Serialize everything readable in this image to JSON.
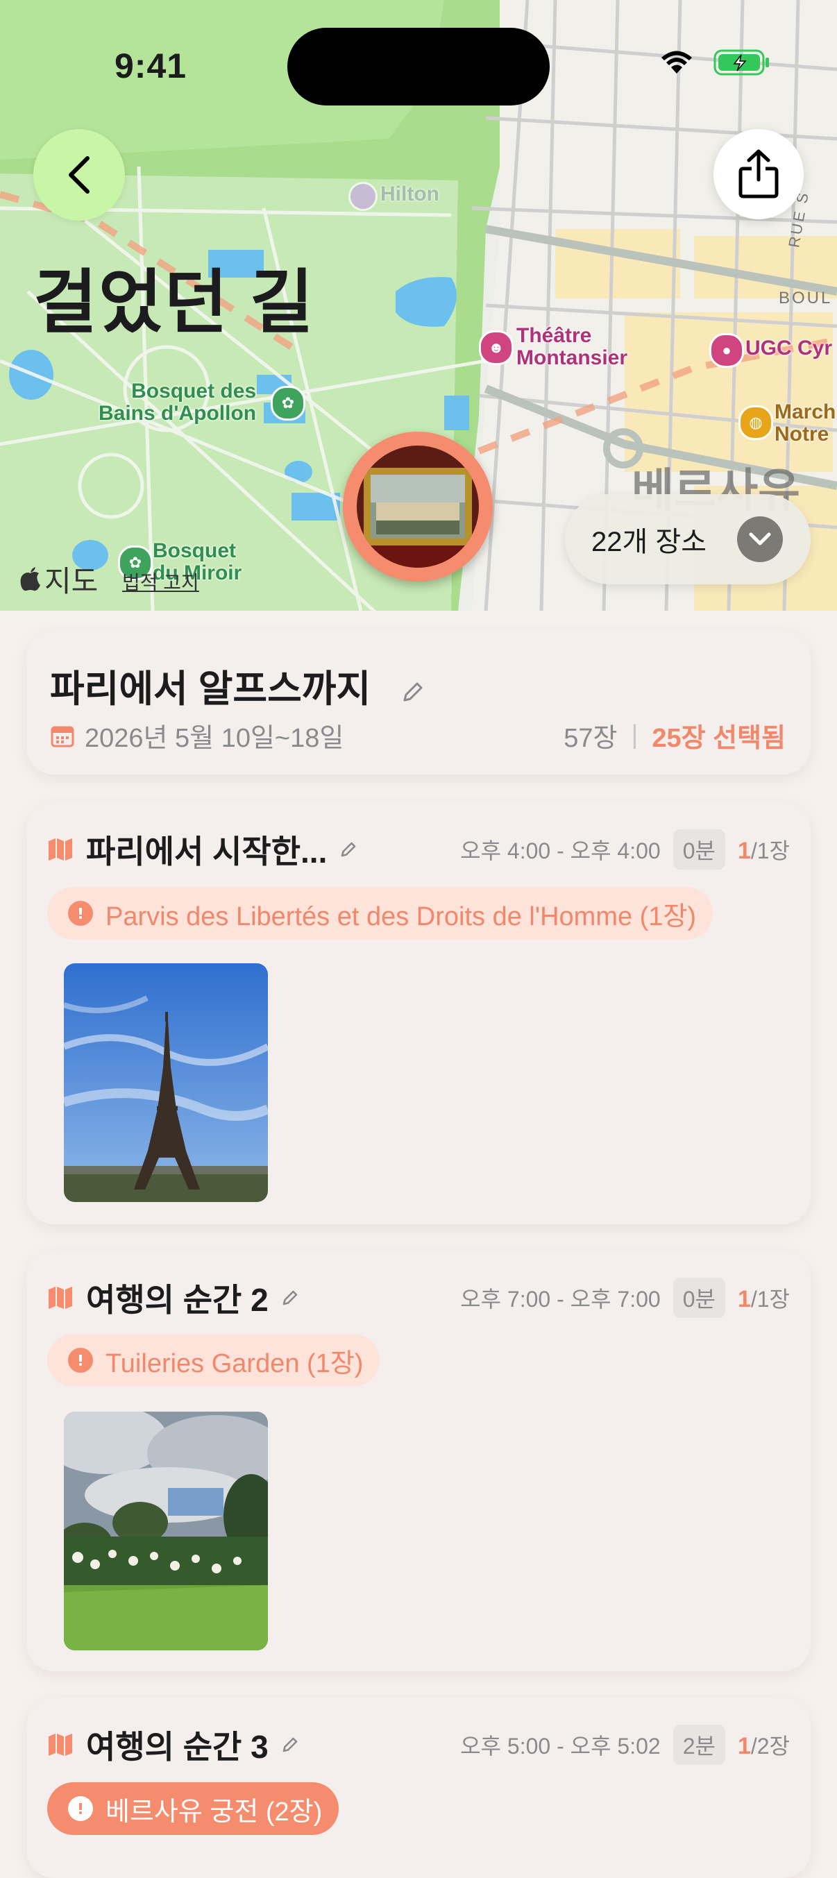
{
  "status": {
    "time": "9:41"
  },
  "header": {
    "title": "걸었던 길",
    "back_icon": "chevron-left-icon",
    "share_icon": "share-icon"
  },
  "map": {
    "labels": {
      "hilton": "Hilton",
      "theatre_line1": "Théâtre",
      "theatre_line2": "Montansier",
      "ugc": "UGC Cyr",
      "bosquet_apollon_line1": "Bosquet des",
      "bosquet_apollon_line2": "Bains d'Apollon",
      "bosquet_miroir_line1": "Bosquet",
      "bosquet_miroir_line2": "du Miroir",
      "marche_line1": "March",
      "marche_line2": "Notre",
      "boulevard": "BOUL",
      "rue": "RUE S",
      "district": "베르사유"
    },
    "places_count": "22개 장소",
    "logo": "지도",
    "legal": "법적 고지"
  },
  "trip": {
    "title": "파리에서 알프스까지",
    "dates": "2026년 5월 10일~18일",
    "total_photos": "57장",
    "selected": "25장 선택됨"
  },
  "segments": [
    {
      "title": "파리에서 시작한...",
      "time_range": "오후 4:00 - 오후 4:00",
      "duration": "0분",
      "count_selected": "1",
      "count_total": "/1장",
      "place": "Parvis des Libertés et des Droits de l'Homme (1장)"
    },
    {
      "title": "여행의 순간 2",
      "time_range": "오후 7:00 - 오후 7:00",
      "duration": "0분",
      "count_selected": "1",
      "count_total": "/1장",
      "place": "Tuileries Garden (1장)"
    },
    {
      "title": "여행의 순간 3",
      "time_range": "오후 5:00 - 오후 5:02",
      "duration": "2분",
      "count_selected": "1",
      "count_total": "/2장",
      "place": "베르사유 궁전 (2장)"
    }
  ],
  "colors": {
    "accent": "#f58c6e",
    "back_button": "#c9f5a6",
    "card_bg": "#f4efec"
  }
}
